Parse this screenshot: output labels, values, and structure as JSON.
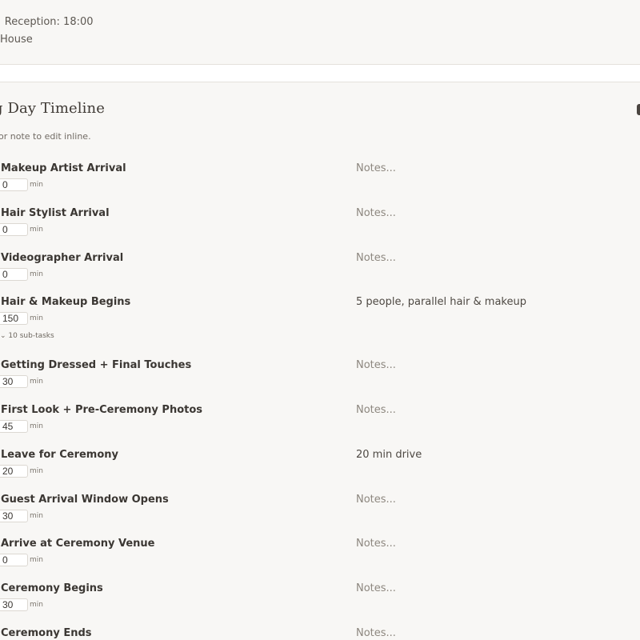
{
  "header": {
    "line1": "• Reception: 18:00",
    "line2": "House"
  },
  "section": {
    "title": "g Day Timeline",
    "hint": "or note to edit inline."
  },
  "duration_unit": "min",
  "events": [
    {
      "name": "Makeup Artist Arrival",
      "minutes": "0",
      "note": "Notes...",
      "note_filled": false
    },
    {
      "name": "Hair Stylist Arrival",
      "minutes": "0",
      "note": "Notes...",
      "note_filled": false
    },
    {
      "name": "Videographer Arrival",
      "minutes": "0",
      "note": "Notes...",
      "note_filled": false
    },
    {
      "name": "Hair & Makeup Begins",
      "minutes": "150",
      "note": "5 people, parallel hair & makeup",
      "note_filled": true,
      "subtasks": "⌄ 10 sub-tasks"
    },
    {
      "name": "Getting Dressed + Final Touches",
      "minutes": "30",
      "note": "Notes...",
      "note_filled": false
    },
    {
      "name": "First Look + Pre-Ceremony Photos",
      "minutes": "45",
      "note": "Notes...",
      "note_filled": false
    },
    {
      "name": "Leave for Ceremony",
      "minutes": "20",
      "note": "20 min drive",
      "note_filled": true
    },
    {
      "name": "Guest Arrival Window Opens",
      "minutes": "30",
      "note": "Notes...",
      "note_filled": false
    },
    {
      "name": "Arrive at Ceremony Venue",
      "minutes": "0",
      "note": "Notes...",
      "note_filled": false
    },
    {
      "name": "Ceremony Begins",
      "minutes": "30",
      "note": "Notes...",
      "note_filled": false
    },
    {
      "name": "Ceremony Ends",
      "minutes": "",
      "note": "Notes...",
      "note_filled": false
    }
  ]
}
